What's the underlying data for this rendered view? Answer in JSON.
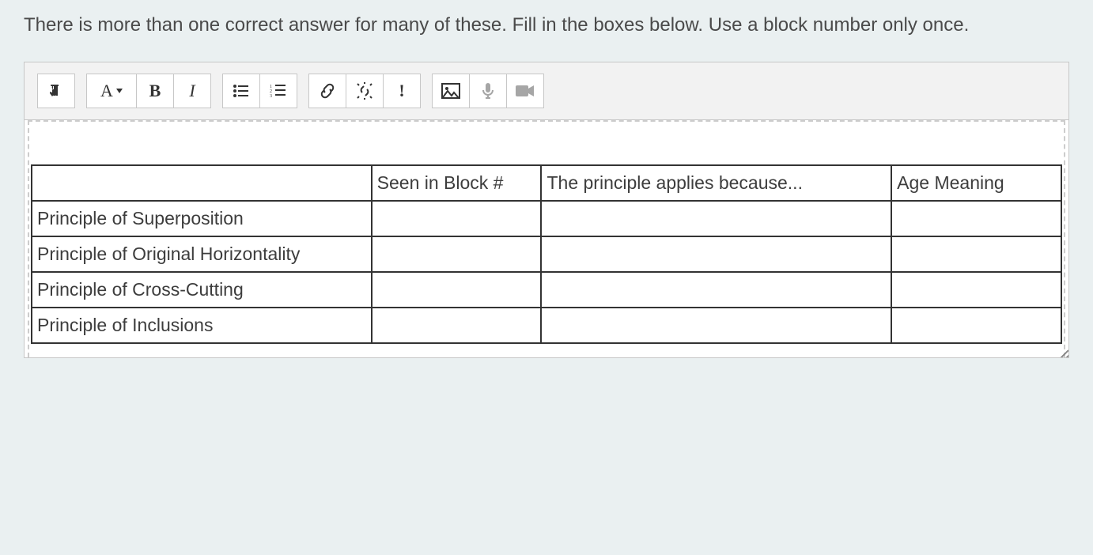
{
  "instructions": "There is more than one correct answer for many of these. Fill in the boxes below. Use a block number only once.",
  "toolbar": {
    "text_direction_icon": "text-direction-icon",
    "font_color_label": "A",
    "bold_label": "B",
    "italic_label": "I",
    "bullet_list_icon": "bullet-list-icon",
    "numbered_list_icon": "numbered-list-icon",
    "link_icon": "link-icon",
    "unlink_icon": "unlink-icon",
    "exclaim_label": "!",
    "image_icon": "image-icon",
    "mic_icon": "microphone-icon",
    "video_icon": "video-icon"
  },
  "table": {
    "headers": [
      "",
      "Seen in Block #",
      "The principle applies because...",
      "Age Meaning"
    ],
    "rows": [
      {
        "label": "Principle of Superposition",
        "block": "",
        "because": "",
        "age": ""
      },
      {
        "label": "Principle of Original Horizontality",
        "block": "",
        "because": "",
        "age": ""
      },
      {
        "label": "Principle of Cross-Cutting",
        "block": "",
        "because": "",
        "age": ""
      },
      {
        "label": "Principle of Inclusions",
        "block": "",
        "because": "",
        "age": ""
      }
    ]
  }
}
